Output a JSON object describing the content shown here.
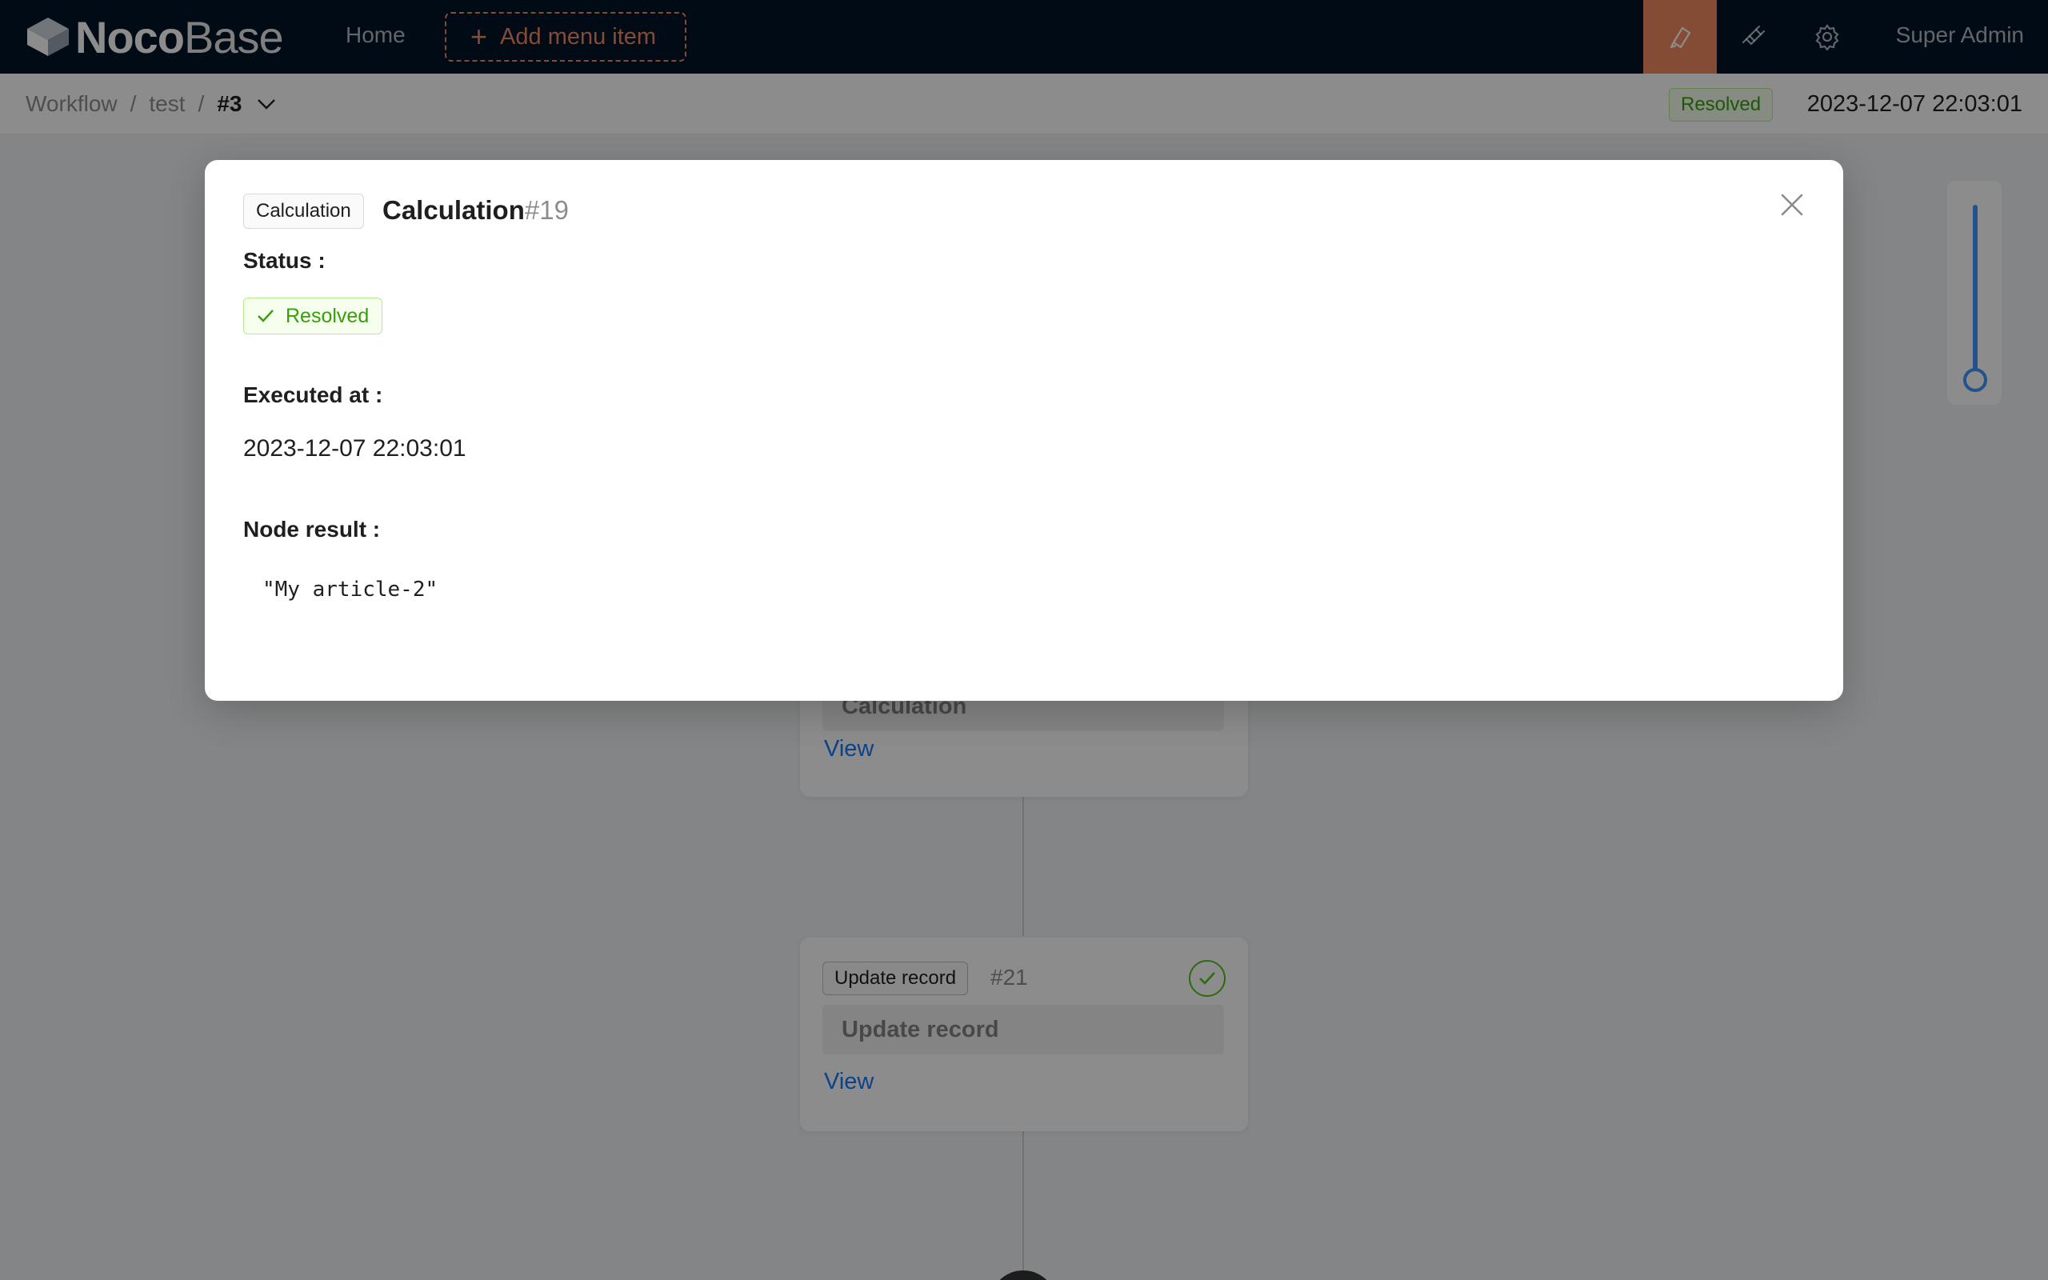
{
  "app": {
    "logo_bold": "Noco",
    "logo_light": "Base",
    "nav_home": "Home",
    "add_menu_label": "Add menu item",
    "user_name": "Super Admin",
    "accent_color": "#f18b62"
  },
  "breadcrumb": {
    "items": [
      "Workflow",
      "test",
      "#3"
    ],
    "separator": "/",
    "status": "Resolved",
    "executed_time": "2023-12-07 22:03:01"
  },
  "canvas": {
    "node_calc": {
      "title": "Calculation",
      "view_label": "View"
    },
    "node_update": {
      "type": "Update record",
      "id": "#21",
      "title": "Update record",
      "view_label": "View"
    }
  },
  "modal": {
    "type_tag": "Calculation",
    "title": "Calculation",
    "title_id": "#19",
    "status_label": "Status :",
    "status_value": "Resolved",
    "executed_label": "Executed at :",
    "executed_value": "2023-12-07 22:03:01",
    "result_label": "Node result :",
    "result_value": "\"My article-2\""
  }
}
